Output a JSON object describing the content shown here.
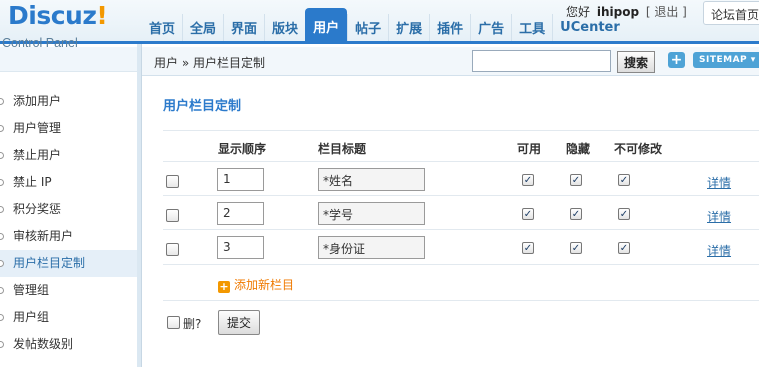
{
  "header": {
    "logo_word": "Discuz",
    "logo_bang": "!",
    "logo_sub": "Control Panel",
    "nav": [
      "首页",
      "全局",
      "界面",
      "版块",
      "用户",
      "帖子",
      "扩展",
      "插件",
      "广告",
      "工具",
      "UCenter"
    ],
    "active_nav": "用户",
    "greeting": "您好",
    "username": "ihipop",
    "logout": "[ 退出 ]",
    "home_button": "论坛首页"
  },
  "sidebar": {
    "items": [
      "添加用户",
      "用户管理",
      "禁止用户",
      "禁止 IP",
      "积分奖惩",
      "审核新用户",
      "用户栏目定制",
      "管理组",
      "用户组",
      "发帖数级别"
    ],
    "active": "用户栏目定制"
  },
  "toolbar": {
    "breadcrumb": "用户 » 用户栏目定制",
    "search_value": "",
    "search_button": "搜索",
    "plus_button": "+",
    "sitemap_button": "SITEMAP ▾"
  },
  "main": {
    "title": "用户栏目定制",
    "columns": {
      "order": "显示顺序",
      "title": "栏目标题",
      "enabled": "可用",
      "hidden": "隐藏",
      "locked": "不可修改"
    },
    "rows": [
      {
        "order": "1",
        "title": "*姓名",
        "enabled": true,
        "hidden": true,
        "locked": true,
        "detail": "详情"
      },
      {
        "order": "2",
        "title": "*学号",
        "enabled": true,
        "hidden": true,
        "locked": true,
        "detail": "详情"
      },
      {
        "order": "3",
        "title": "*身份证",
        "enabled": true,
        "hidden": true,
        "locked": true,
        "detail": "详情"
      }
    ],
    "add_column": "添加新栏目",
    "delete_label": "删?",
    "submit": "提交"
  },
  "colors": {
    "accent": "#2b7acb",
    "orange": "#f39800",
    "link": "#2b6ea8"
  }
}
